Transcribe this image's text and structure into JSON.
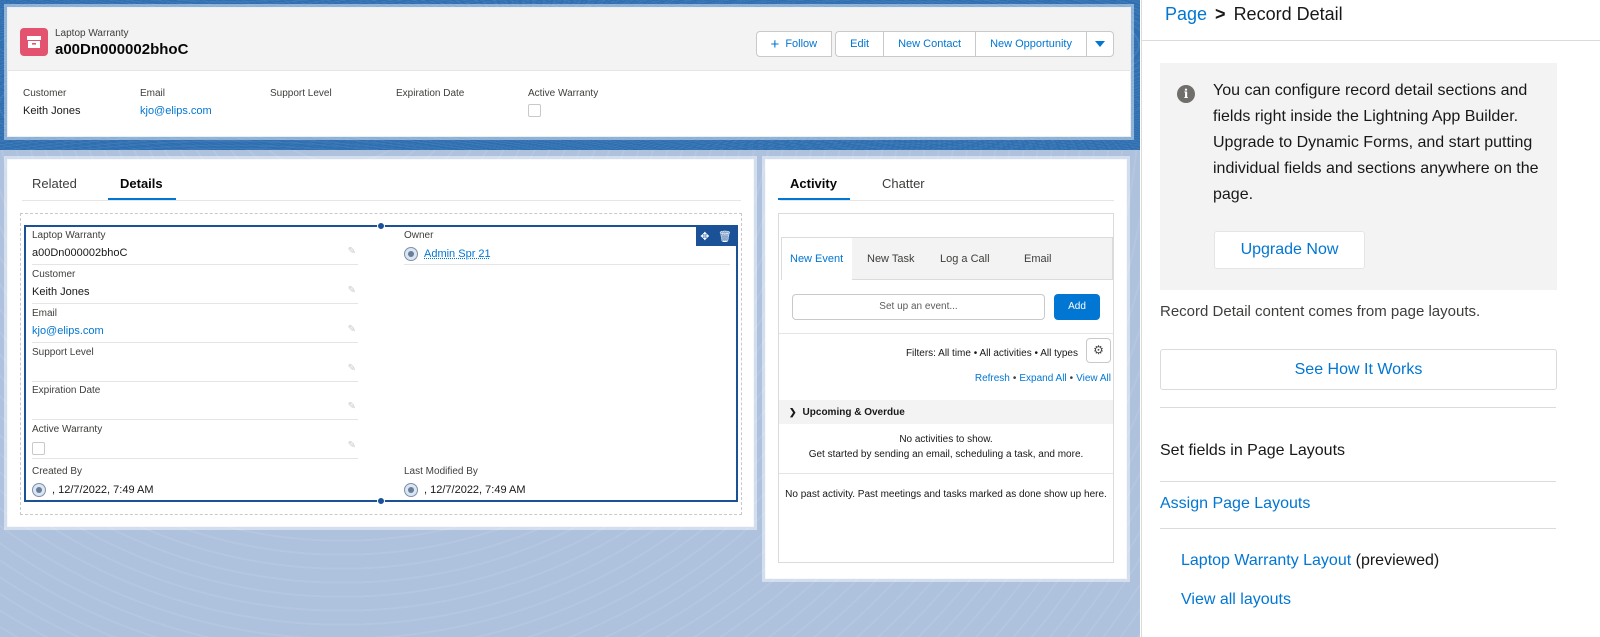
{
  "highlights": {
    "object_label": "Laptop Warranty",
    "record_name": "a00Dn000002bhoC",
    "buttons": {
      "follow": "Follow",
      "edit": "Edit",
      "new_contact": "New Contact",
      "new_opportunity": "New Opportunity"
    },
    "fields": [
      {
        "label": "Customer",
        "value": "Keith Jones"
      },
      {
        "label": "Email",
        "value": "kjo@elips.com"
      },
      {
        "label": "Support Level",
        "value": ""
      },
      {
        "label": "Expiration Date",
        "value": ""
      },
      {
        "label": "Active Warranty",
        "value": ""
      }
    ]
  },
  "details": {
    "tabs": [
      "Related",
      "Details"
    ],
    "active_tab": "Details",
    "left_fields": [
      {
        "label": "Laptop Warranty",
        "value": "a00Dn000002bhoC"
      },
      {
        "label": "Customer",
        "value": "Keith Jones"
      },
      {
        "label": "Email",
        "value": "kjo@elips.com"
      },
      {
        "label": "Support Level",
        "value": ""
      },
      {
        "label": "Expiration Date",
        "value": ""
      },
      {
        "label": "Active Warranty",
        "value": ""
      }
    ],
    "owner": {
      "label": "Owner",
      "value": "Admin Spr 21"
    },
    "created_by": {
      "label": "Created By",
      "value": ", 12/7/2022, 7:49 AM"
    },
    "last_modified_by": {
      "label": "Last Modified By",
      "value": ", 12/7/2022, 7:49 AM"
    }
  },
  "activity": {
    "tabs": [
      "Activity",
      "Chatter"
    ],
    "active_tab": "Activity",
    "composer_tabs": [
      "New Event",
      "New Task",
      "Log a Call",
      "Email"
    ],
    "event_placeholder": "Set up an event...",
    "add_label": "Add",
    "filters": "Filters: All time • All activities • All types",
    "links": {
      "refresh": "Refresh",
      "expand_all": "Expand All",
      "view_all": "View All",
      "sep": "•"
    },
    "upcoming_label": "Upcoming & Overdue",
    "no_activities": "No activities to show.",
    "get_started": "Get started by sending an email, scheduling a task, and more.",
    "no_past": "No past activity. Past meetings and tasks marked as done show up here."
  },
  "sidebar": {
    "crumb_parent": "Page",
    "crumb_sep": ">",
    "crumb_current": "Record Detail",
    "info_text": "You can configure record detail sections and fields right inside the Lightning App Builder. Upgrade to Dynamic Forms, and start putting individual fields and sections anywhere on the page.",
    "upgrade_label": "Upgrade Now",
    "layout_source": "Record Detail content comes from page layouts.",
    "see_how_label": "See How It Works",
    "set_fields": "Set fields in Page Layouts",
    "assign_layouts": "Assign Page Layouts",
    "layout_name": "Laptop Warranty Layout",
    "previewed": "(previewed)",
    "view_all_layouts": "View all layouts"
  },
  "colors": {
    "brand": "#0176d3",
    "object_icon": "#e3526e",
    "selection": "#1b5297"
  }
}
